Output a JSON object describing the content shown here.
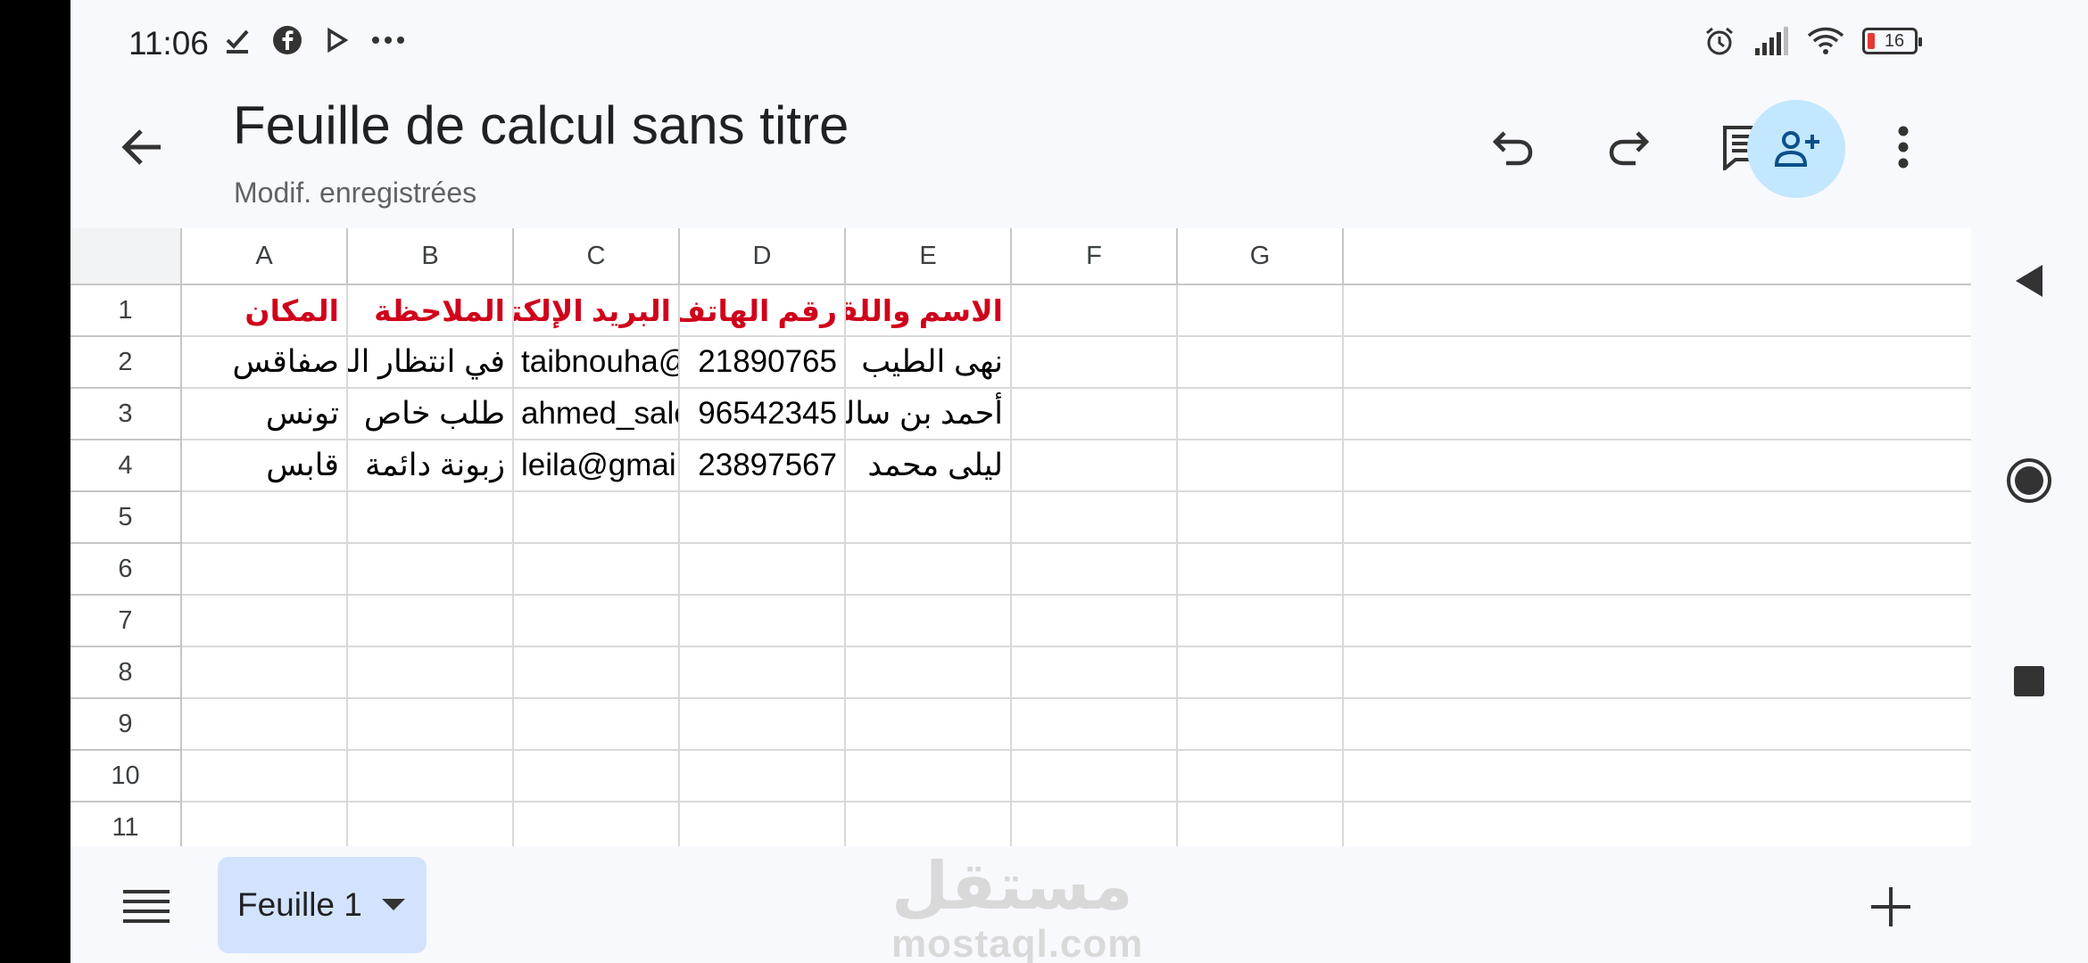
{
  "status": {
    "time": "11:06",
    "battery": "16"
  },
  "header": {
    "title": "Feuille de calcul sans titre",
    "subtitle": "Modif. enregistrées"
  },
  "columns": [
    "A",
    "B",
    "C",
    "D",
    "E",
    "F",
    "G"
  ],
  "rows": [
    "1",
    "2",
    "3",
    "4",
    "5",
    "6",
    "7",
    "8",
    "9",
    "10",
    "11"
  ],
  "cells": {
    "r1": {
      "A": "المكان",
      "B": "الملاحظة",
      "C": "البريد الإلكتروني",
      "D": "رقم الهاتف",
      "E": "الاسم واللقب"
    },
    "r2": {
      "A": "صفاقس",
      "B": "في انتظار الدفع",
      "C": "taibnouha@yahoo",
      "D": "21890765",
      "E": "نهى الطيب"
    },
    "r3": {
      "A": "تونس",
      "B": "طلب خاص",
      "C": "ahmed_salem@",
      "D": "96542345",
      "E": "أحمد بن سالم"
    },
    "r4": {
      "A": "قابس",
      "B": "زبونة دائمة",
      "C": "leila@gmail.fr",
      "D": "23897567",
      "E": "ليلى محمد"
    }
  },
  "bottom": {
    "sheet_name": "Feuille 1"
  },
  "watermark": {
    "arabic": "مستقل",
    "latin": "mostaql.com"
  },
  "colors": {
    "header_text": "#d0021b",
    "share_bg": "#c2e7ff",
    "sheet_tab_bg": "#d3e3fd"
  }
}
